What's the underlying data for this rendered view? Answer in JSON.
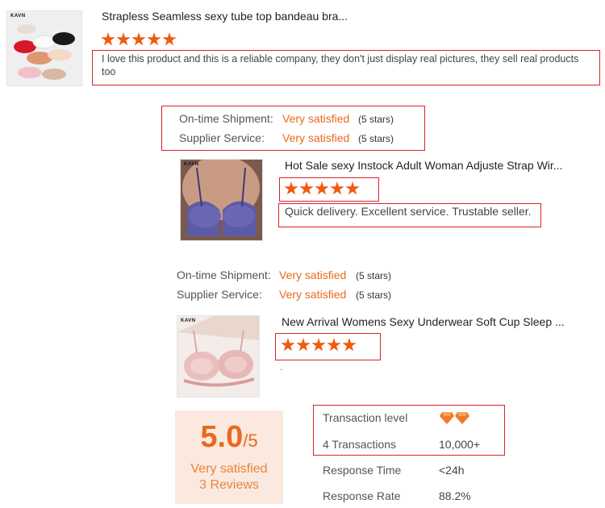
{
  "review1": {
    "title": "Strapless Seamless sexy tube top bandeau bra...",
    "brand": "KAVN",
    "rating": 5,
    "comment": "I love this product and this is a reliable company, they don't just display real pictures, they sell real products too"
  },
  "ratings1": {
    "shipment_label": "On-time Shipment:",
    "shipment_value": "Very satisfied",
    "shipment_stars": "(5 stars)",
    "service_label": "Supplier Service:",
    "service_value": "Very satisfied",
    "service_stars": "(5 stars)"
  },
  "review2": {
    "title": "Hot Sale sexy Instock Adult Woman Adjuste Strap Wir...",
    "brand": "KAVN",
    "rating": 5,
    "comment": "Quick delivery. Excellent service. Trustable seller."
  },
  "ratings2": {
    "shipment_label": "On-time Shipment:",
    "shipment_value": "Very satisfied",
    "shipment_stars": "(5 stars)",
    "service_label": "Supplier Service:",
    "service_value": "Very satisfied",
    "service_stars": "(5 stars)"
  },
  "review3": {
    "title": "New Arrival Womens Sexy Underwear Soft Cup Sleep ...",
    "brand": "KAVN",
    "rating": 5,
    "comment": "."
  },
  "summary": {
    "score": "5.0",
    "out_of": "/5",
    "label": "Very satisfied",
    "reviews": "3 Reviews"
  },
  "metrics": {
    "transaction_level_label": "Transaction level",
    "transactions_label": "4 Transactions",
    "transactions_value": "10,000+",
    "response_time_label": "Response Time",
    "response_time_value": "<24h",
    "response_rate_label": "Response Rate",
    "response_rate_value": "88.2%"
  },
  "colors": {
    "accent": "#f05a0f",
    "highlight_border": "#d9232e",
    "score_bg": "#fbe9df"
  }
}
